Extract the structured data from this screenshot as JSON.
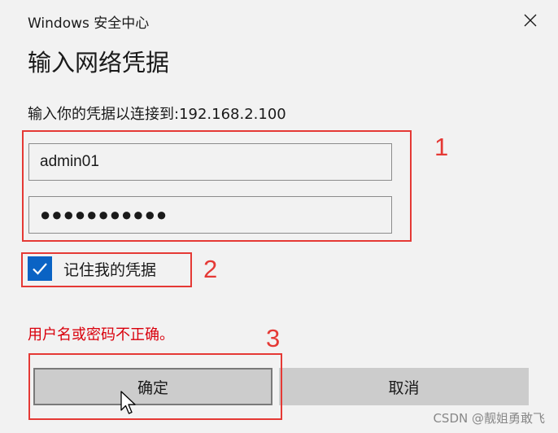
{
  "window": {
    "title": "Windows 安全中心",
    "close_icon": "close-icon"
  },
  "dialog": {
    "heading": "输入网络凭据",
    "prompt": "输入你的凭据以连接到:192.168.2.100",
    "username_value": "admin01",
    "password_value": "●●●●●●●●●●●",
    "remember_label": "记住我的凭据",
    "remember_checked": true,
    "error_text": "用户名或密码不正确。",
    "ok_label": "确定",
    "cancel_label": "取消"
  },
  "annotations": {
    "label_1": "1",
    "label_2": "2",
    "label_3": "3",
    "color": "#e53935"
  },
  "colors": {
    "accent": "#0a63c4",
    "error": "#d9000c",
    "dialog_bg": "#f2f2f2"
  },
  "watermark": "CSDN @靓姐勇敢飞"
}
